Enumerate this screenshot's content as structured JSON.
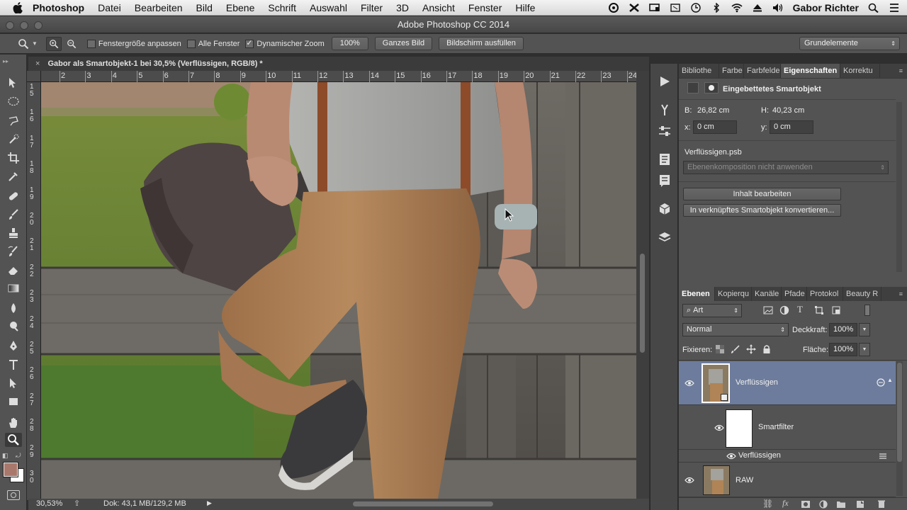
{
  "menubar": {
    "app": "Photoshop",
    "items": [
      "Datei",
      "Bearbeiten",
      "Bild",
      "Ebene",
      "Schrift",
      "Auswahl",
      "Filter",
      "3D",
      "Ansicht",
      "Fenster",
      "Hilfe"
    ],
    "user": "Gabor Richter"
  },
  "window": {
    "title": "Adobe Photoshop CC 2014"
  },
  "options": {
    "fit_window": "Fenstergröße anpassen",
    "all_windows": "Alle Fenster",
    "dynamic_zoom": "Dynamischer Zoom",
    "zoom_pct": "100%",
    "fit_screen": "Ganzes Bild",
    "fill_screen": "Bildschirm ausfüllen",
    "workspace": "Grundelemente"
  },
  "document": {
    "tab_title": "Gabor als Smartobjekt-1 bei 30,5% (Verflüssigen, RGB/8) *",
    "zoom": "30,53%",
    "doc_size": "Dok: 43,1 MB/129,2 MB"
  },
  "rulers": {
    "h": [
      "2",
      "3",
      "4",
      "5",
      "6",
      "7",
      "8",
      "9",
      "10",
      "11",
      "12",
      "13",
      "14",
      "15",
      "16",
      "17",
      "18",
      "19",
      "20",
      "21",
      "22",
      "23",
      "24"
    ],
    "v": [
      "1 5",
      "1 6",
      "1 7",
      "1 8",
      "1 9",
      "2 0",
      "2 1",
      "2 2",
      "2 3",
      "2 4",
      "2 5",
      "2 6",
      "2 7",
      "2 8",
      "2 9",
      "3 0"
    ]
  },
  "properties": {
    "tabs": [
      "Bibliothe",
      "Farbe",
      "Farbfelde",
      "Eigenschaften",
      "Korrektu"
    ],
    "active_tab": "Eigenschaften",
    "header": "Eingebettetes Smartobjekt",
    "b_label": "B:",
    "b_value": "26,82 cm",
    "h_label": "H:",
    "h_value": "40,23 cm",
    "x_label": "x:",
    "x_value": "0 cm",
    "y_label": "y:",
    "y_value": "0 cm",
    "file": "Verflüssigen.psb",
    "comp": "Ebenenkomposition nicht anwenden",
    "edit_btn": "Inhalt bearbeiten",
    "convert_btn": "In verknüpftes Smartobjekt konvertieren..."
  },
  "layers": {
    "tabs": [
      "Ebenen",
      "Kopierqu",
      "Kanäle",
      "Pfade",
      "Protokol",
      "Beauty R"
    ],
    "active_tab": "Ebenen",
    "filter_kind": "Art",
    "blend_mode": "Normal",
    "opacity_label": "Deckkraft:",
    "opacity": "100%",
    "lock_label": "Fixieren:",
    "fill_label": "Fläche:",
    "fill": "100%",
    "items": [
      {
        "name": "Verflüssigen"
      },
      {
        "name": "Smartfilter"
      },
      {
        "name": "Verflüssigen"
      },
      {
        "name": "RAW"
      }
    ]
  },
  "colors": {
    "accent_selected": "#6d7c9c",
    "panel": "#535353",
    "foreground": "#a9786c",
    "background": "#ffffff"
  }
}
